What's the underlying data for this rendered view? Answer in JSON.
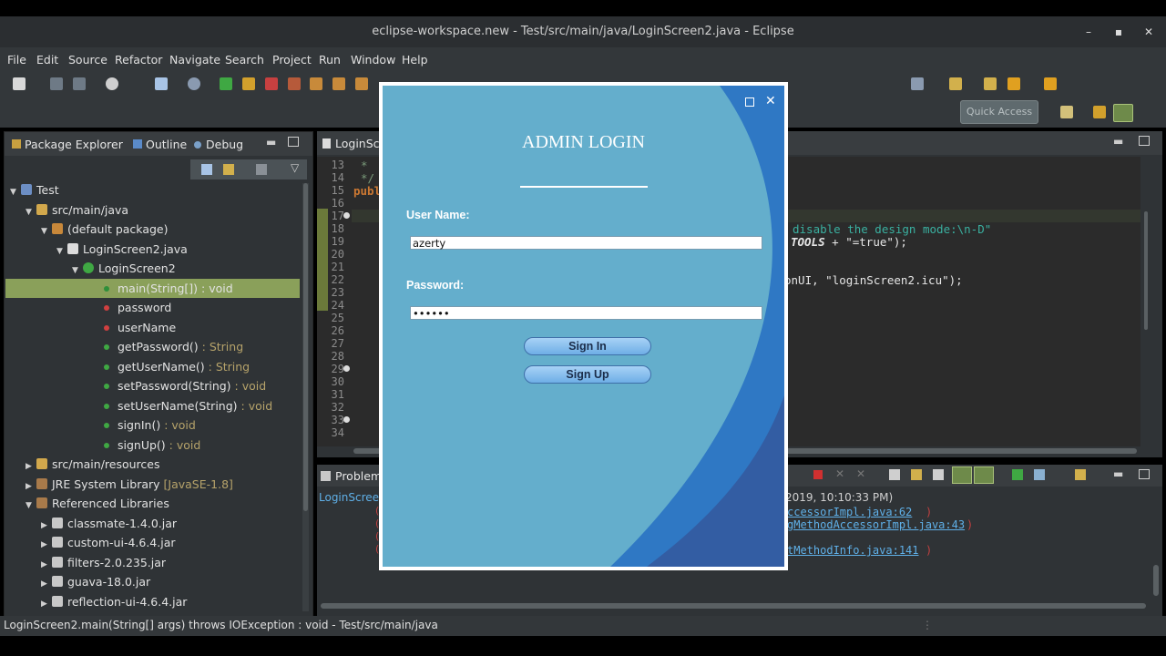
{
  "window": {
    "title": "eclipse-workspace.new - Test/src/main/java/LoginScreen2.java - Eclipse"
  },
  "menu": [
    "File",
    "Edit",
    "Source",
    "Refactor",
    "Navigate",
    "Search",
    "Project",
    "Run",
    "Window",
    "Help"
  ],
  "toolbar": {
    "quick_access": "Quick Access"
  },
  "left_panel": {
    "tabs": [
      "Package Explorer",
      "Outline",
      "Debug"
    ],
    "tree": [
      {
        "label": "Test",
        "sub": ""
      },
      {
        "label": "src/main/java",
        "sub": ""
      },
      {
        "label": "(default package)",
        "sub": ""
      },
      {
        "label": "LoginScreen2.java",
        "sub": ""
      },
      {
        "label": "LoginScreen2",
        "sub": ""
      },
      {
        "label": "main(String[]) : void",
        "sub": ""
      },
      {
        "label": "password",
        "sub": ""
      },
      {
        "label": "userName",
        "sub": ""
      },
      {
        "label": "getPassword()",
        "sub": " : String"
      },
      {
        "label": "getUserName()",
        "sub": " : String"
      },
      {
        "label": "setPassword(String)",
        "sub": " : void"
      },
      {
        "label": "setUserName(String)",
        "sub": " : void"
      },
      {
        "label": "signIn()",
        "sub": " : void"
      },
      {
        "label": "signUp()",
        "sub": " : void"
      },
      {
        "label": "src/main/resources",
        "sub": ""
      },
      {
        "label": "JRE System Library",
        "sub": " [JavaSE-1.8]"
      },
      {
        "label": "Referenced Libraries",
        "sub": ""
      },
      {
        "label": "classmate-1.4.0.jar",
        "sub": ""
      },
      {
        "label": "custom-ui-4.6.4.jar",
        "sub": ""
      },
      {
        "label": "filters-2.0.235.jar",
        "sub": ""
      },
      {
        "label": "guava-18.0.jar",
        "sub": ""
      },
      {
        "label": "reflection-ui-4.6.4.jar",
        "sub": ""
      }
    ]
  },
  "editor": {
    "tab": "LoginScr",
    "line_numbers": [
      "13",
      "14",
      "15",
      "16",
      "17",
      "18",
      "19",
      "20",
      "21",
      "22",
      "23",
      "24",
      "25",
      "26",
      "27",
      "28",
      "29",
      "30",
      "31",
      "32",
      "33",
      "34"
    ],
    "code_left": [
      "*",
      "*/",
      "publ"
    ],
    "code_right_1": "disable the design mode:\\n-D\"",
    "code_right_2a": "TOOLS",
    "code_right_2b": " + \"=true\");",
    "code_right_3": "onUI, \"loginScreen2.icu\");"
  },
  "console": {
    "tab": "Problem",
    "source": "LoginScreen",
    "time_fragment": "2019, 10:10:33 PM)",
    "lines": [
      "ccessorImpl.java:62",
      "gMethodAccessorImpl.java:43",
      "tMethodInfo.java:141"
    ]
  },
  "status_bar": "LoginScreen2.main(String[] args) throws IOException : void - Test/src/main/java",
  "dialog": {
    "title": "ADMIN LOGIN",
    "username_label": "User Name:",
    "username_value": "azerty",
    "password_label": "Password:",
    "password_value": "••••••",
    "sign_in": "Sign In",
    "sign_up": "Sign Up"
  },
  "colors": {
    "accent_selection": "#8aa05a",
    "dialog_bg": "#64aecc",
    "dialog_wave": "#2f78c4"
  }
}
